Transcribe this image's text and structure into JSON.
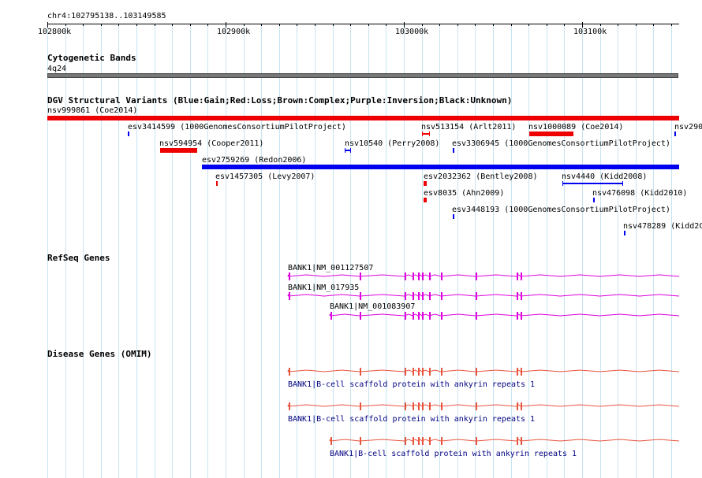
{
  "header": {
    "locus": "chr4:102795138..103149585",
    "scale_labels": [
      "102800k",
      "102900k",
      "103000k",
      "103100k"
    ]
  },
  "tracks": {
    "cytoband": {
      "title": "Cytogenetic Bands",
      "band": "4q24"
    },
    "dgv": {
      "title": "DGV Structural Variants (Blue:Gain;Red:Loss;Brown:Complex;Purple:Inversion;Black:Unknown)",
      "colors": {
        "gain": "#0000ee",
        "loss": "#ee0000"
      },
      "variants": [
        {
          "label": "nsv999861 (Coe2014)",
          "type": "loss"
        },
        {
          "label": "esv3414599 (1000GenomesConsortiumPilotProject)",
          "type": "gain"
        },
        {
          "label": "nsv513154 (Arlt2011)",
          "type": "loss"
        },
        {
          "label": "nsv1000089 (Coe2014)",
          "type": "loss"
        },
        {
          "label": "nsv290",
          "type": "gain"
        },
        {
          "label": "nsv594954 (Cooper2011)",
          "type": "loss"
        },
        {
          "label": "nsv10540 (Perry2008)",
          "type": "gain"
        },
        {
          "label": "esv3306945 (1000GenomesConsortiumPilotProject)",
          "type": "gain"
        },
        {
          "label": "esv2759269 (Redon2006)",
          "type": "gain"
        },
        {
          "label": "esv1457305 (Levy2007)",
          "type": "loss"
        },
        {
          "label": "esv2032362 (Bentley2008)",
          "type": "loss"
        },
        {
          "label": "nsv4440 (Kidd2008)",
          "type": "gain"
        },
        {
          "label": "esv8035 (Ahn2009)",
          "type": "loss"
        },
        {
          "label": "nsv476098 (Kidd2010)",
          "type": "gain"
        },
        {
          "label": "esv3448193 (1000GenomesConsortiumPilotProject)",
          "type": "gain"
        },
        {
          "label": "nsv478289 (Kidd2C",
          "type": "gain"
        }
      ]
    },
    "refseq": {
      "title": "RefSeq Genes",
      "color": "#dd00dd",
      "genes": [
        {
          "label": "BANK1|NM_001127507"
        },
        {
          "label": "BANK1|NM_017935"
        },
        {
          "label": "BANK1|NM_001083907"
        }
      ]
    },
    "omim": {
      "title": "Disease Genes (OMIM)",
      "color": "#e8553f",
      "genes": [
        {
          "label": "BANK1|B-cell scaffold protein with ankyrin repeats 1"
        },
        {
          "label": "BANK1|B-cell scaffold protein with ankyrin repeats 1"
        },
        {
          "label": "BANK1|B-cell scaffold protein with ankyrin repeats 1"
        }
      ]
    }
  }
}
